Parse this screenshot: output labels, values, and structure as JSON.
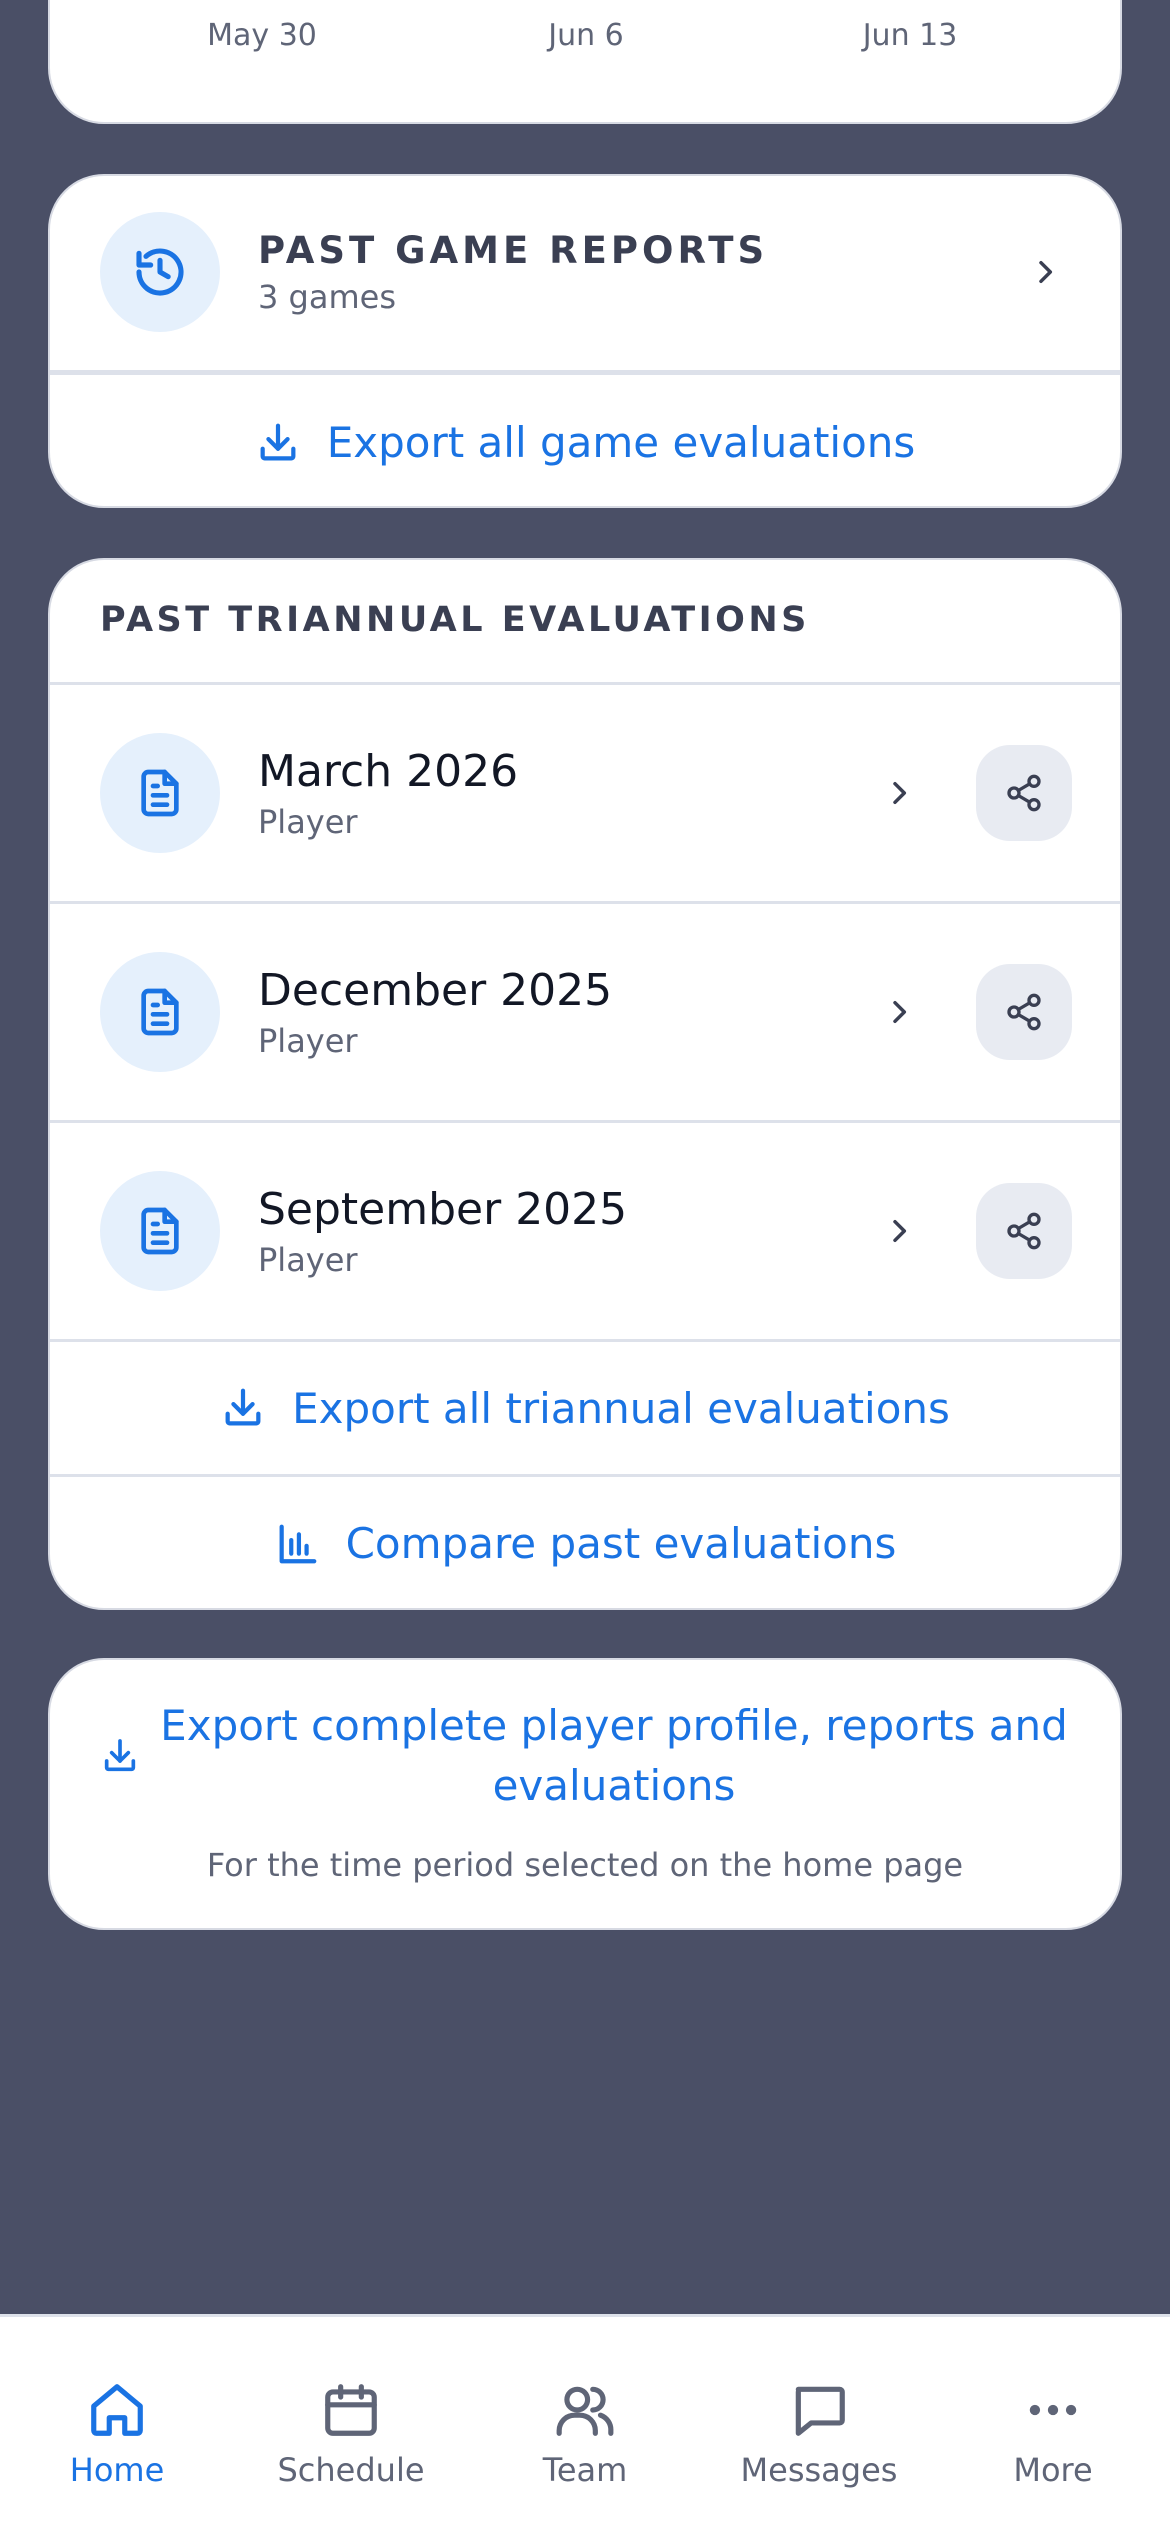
{
  "chart_axis": {
    "ticks": [
      "May 30",
      "Jun 6",
      "Jun 13"
    ]
  },
  "game_reports": {
    "title": "PAST GAME REPORTS",
    "subtitle": "3 games",
    "icon": "history-icon",
    "export_label": "Export all game evaluations"
  },
  "triannual": {
    "title": "PAST TRIANNUAL EVALUATIONS",
    "items": [
      {
        "title": "March 2026",
        "subtitle": "Player"
      },
      {
        "title": "December 2025",
        "subtitle": "Player"
      },
      {
        "title": "September 2025",
        "subtitle": "Player"
      }
    ],
    "export_label": "Export all triannual evaluations",
    "compare_label": "Compare past evaluations"
  },
  "profile_export": {
    "label": "Export complete player profile, reports and evaluations",
    "note": "For the time period selected on the home page"
  },
  "bottom_nav": {
    "items": [
      {
        "label": "Home",
        "icon": "home-icon",
        "active": true
      },
      {
        "label": "Schedule",
        "icon": "calendar-icon",
        "active": false
      },
      {
        "label": "Team",
        "icon": "users-icon",
        "active": false
      },
      {
        "label": "Messages",
        "icon": "message-icon",
        "active": false
      },
      {
        "label": "More",
        "icon": "more-icon",
        "active": false
      }
    ]
  },
  "colors": {
    "background": "#4a4f66",
    "accent": "#1a73e3",
    "icon_tile": "#e5f0fc"
  }
}
